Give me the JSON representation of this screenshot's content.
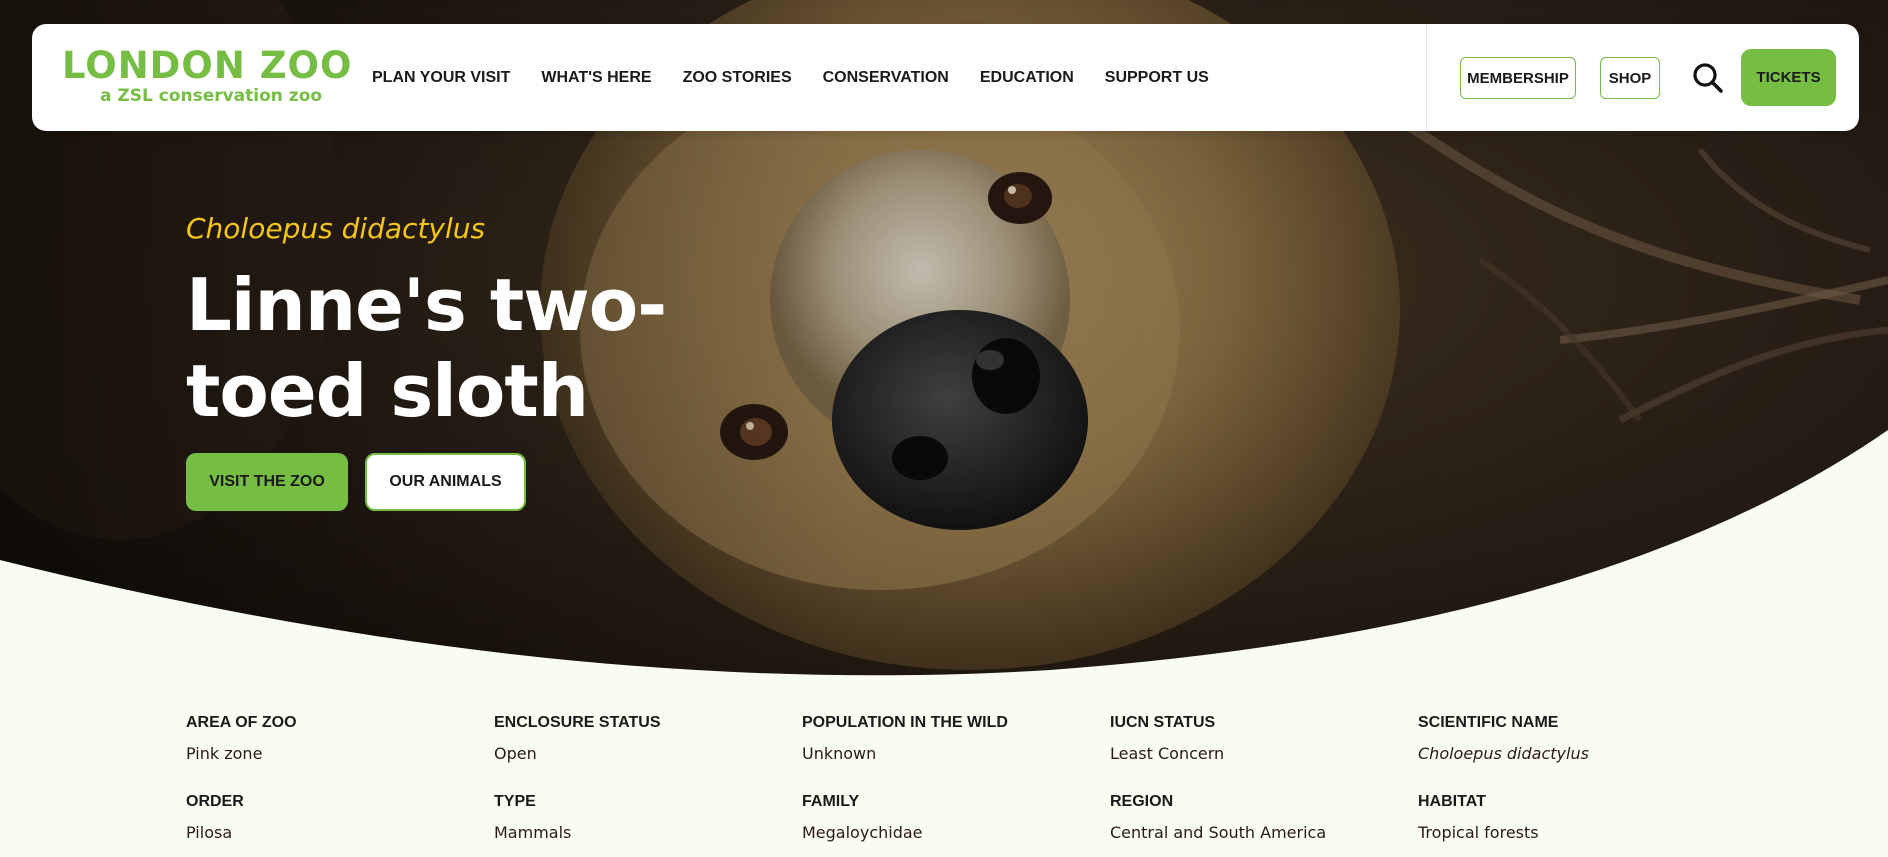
{
  "brand": {
    "name": "LONDON ZOO",
    "tagline": "a ZSL conservation zoo",
    "color": "#75bd43"
  },
  "nav": {
    "items": [
      {
        "label": "PLAN YOUR VISIT"
      },
      {
        "label": "WHAT'S HERE"
      },
      {
        "label": "ZOO STORIES"
      },
      {
        "label": "CONSERVATION"
      },
      {
        "label": "EDUCATION"
      },
      {
        "label": "SUPPORT US"
      }
    ],
    "membership_label": "MEMBERSHIP",
    "shop_label": "SHOP",
    "search_icon": "search-icon",
    "tickets_label": "TICKETS"
  },
  "hero": {
    "scientific_name": "Choloepus didactylus",
    "title": "Linne's two-toed sloth",
    "image": "sloth face close-up photo",
    "primary_button": "VISIT THE ZOO",
    "secondary_button": "OUR ANIMALS",
    "accent_color": "#f5c518"
  },
  "facts": {
    "row1": [
      {
        "label": "AREA OF ZOO",
        "value": "Pink zone"
      },
      {
        "label": "ENCLOSURE STATUS",
        "value": "Open"
      },
      {
        "label": "POPULATION IN THE WILD",
        "value": "Unknown"
      },
      {
        "label": "IUCN STATUS",
        "value": "Least Concern"
      },
      {
        "label": "SCIENTIFIC NAME",
        "value": "Choloepus didactylus"
      }
    ],
    "row2": [
      {
        "label": "ORDER",
        "value": "Pilosa"
      },
      {
        "label": "TYPE",
        "value": "Mammals"
      },
      {
        "label": "FAMILY",
        "value": "Megaloychidae"
      },
      {
        "label": "REGION",
        "value": "Central and South America"
      },
      {
        "label": "HABITAT",
        "value": "Tropical forests"
      }
    ]
  }
}
